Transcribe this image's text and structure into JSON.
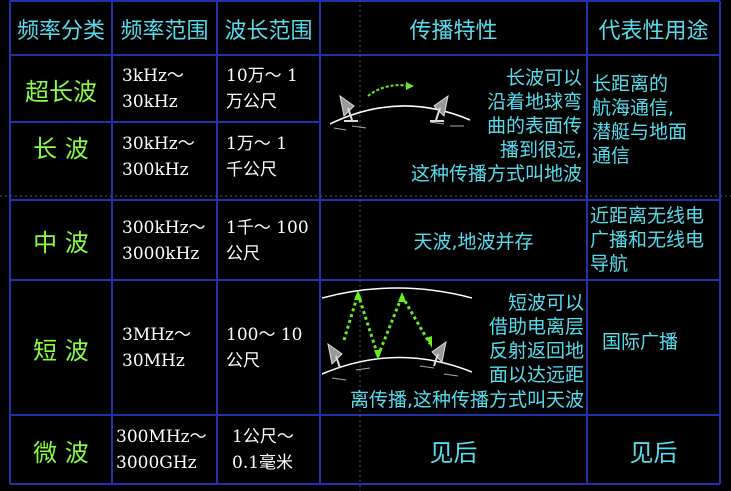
{
  "table": {
    "headers": [
      "频率分类",
      "频率范围",
      "波长范围",
      "传播特性",
      "代表性用途"
    ],
    "rows": [
      {
        "class": "超长波",
        "freq": [
          "3kHz～",
          "30kHz"
        ],
        "wave": [
          "10万～ 1",
          "万公尺"
        ]
      },
      {
        "class": "长  波",
        "freq": [
          "30kHz～",
          "300kHz"
        ],
        "wave": [
          "1万～ 1",
          "千公尺"
        ]
      },
      {
        "class": "中  波",
        "freq": [
          "300kHz～",
          "3000kHz"
        ],
        "wave": [
          "1千～ 100",
          "公尺"
        ]
      },
      {
        "class": "短  波",
        "freq": [
          "3MHz～",
          "30MHz"
        ],
        "wave": [
          "100～ 10",
          "公尺"
        ]
      },
      {
        "class": "微  波",
        "freq": [
          "300MHz～",
          "3000GHz"
        ],
        "wave": [
          "1公尺～",
          "0.1毫米"
        ]
      }
    ],
    "propagation": {
      "long": "长波可以\n沿着地球弯\n曲的表面传\n播到很远,\n这种传播方式叫地波",
      "medium": "天波,地波并存",
      "short_right": "短波可以\n借助电离层\n反射返回地\n面以达远距",
      "short_bottom": "离传播,这种传播方式叫天波",
      "micro": "见后"
    },
    "uses": {
      "long": "  长距离的\n航海通信,\n潜艇与地面\n通信",
      "medium": "近距离无线电\n广播和无线电\n导航",
      "short": "国际广播",
      "micro": "见后"
    }
  },
  "colors": {
    "background": "#000000",
    "header_text": "#55ddee",
    "class_text": "#88ff44",
    "value_text": "#ffffff",
    "grid_line": "#2233aa",
    "arrow_green": "#66ee22"
  },
  "icons": [
    "satellite-dish-icon",
    "dotted-arrow-icon"
  ]
}
